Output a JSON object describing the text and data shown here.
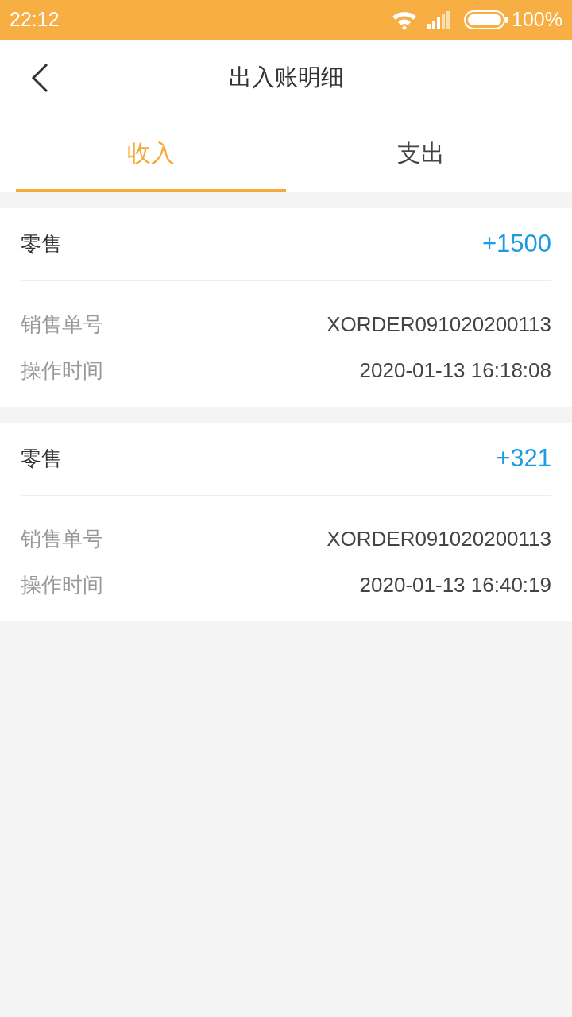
{
  "status_bar": {
    "time": "22:12",
    "battery": "100%"
  },
  "header": {
    "title": "出入账明细"
  },
  "tabs": [
    {
      "label": "收入",
      "selected": true
    },
    {
      "label": "支出",
      "selected": false
    }
  ],
  "records": [
    {
      "type": "零售",
      "amount": "+1500",
      "fields": [
        {
          "label": "销售单号",
          "value": "XORDER091020200113"
        },
        {
          "label": "操作时间",
          "value": "2020-01-13 16:18:08"
        }
      ]
    },
    {
      "type": "零售",
      "amount": "+321",
      "fields": [
        {
          "label": "销售单号",
          "value": "XORDER091020200113"
        },
        {
          "label": "操作时间",
          "value": "2020-01-13 16:40:19"
        }
      ]
    }
  ]
}
